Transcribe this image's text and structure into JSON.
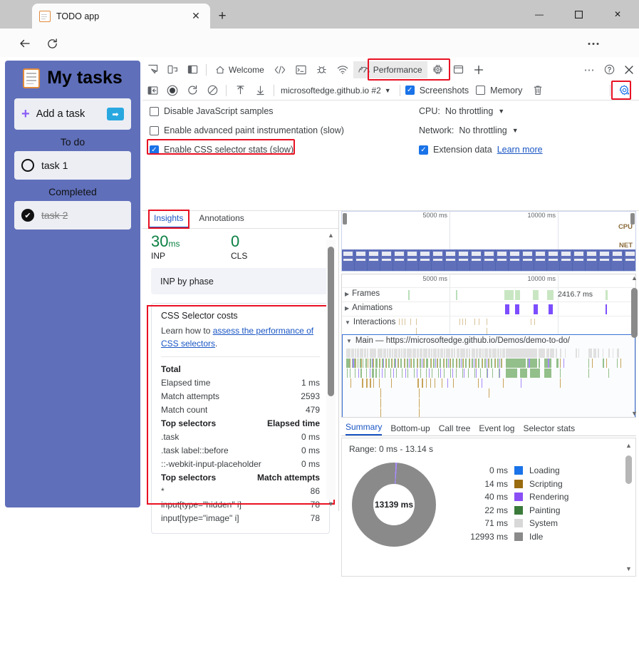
{
  "browser": {
    "tab_title": "TODO app",
    "url_prefix": "https://",
    "url_domain": "microsoftedge.github.io",
    "url_path": "/Demos/demo-to-do/",
    "new_tab_label": "+",
    "close_tab_label": "✕",
    "minimize_label": "—",
    "maximize_label": "❐",
    "close_label": "✕",
    "read_aloud_icon": "read-aloud-icon",
    "favorite_icon": "star-icon",
    "settings_more_icon": "ellipsis-icon",
    "copilot_icon": "copilot-icon"
  },
  "todo": {
    "title": "My tasks",
    "add_task_label": "Add a task",
    "add_task_submit": "➡",
    "sections": [
      {
        "heading": "To do",
        "tasks": [
          {
            "label": "task 1",
            "done": false
          }
        ]
      },
      {
        "heading": "Completed",
        "tasks": [
          {
            "label": "task 2",
            "done": true
          }
        ]
      }
    ]
  },
  "devtools": {
    "toolbar_row1": {
      "icons": [
        "inspect-icon",
        "device-toolbar-icon",
        "dock-side-icon"
      ],
      "panels": [
        {
          "label": "Welcome",
          "icon": "home-icon",
          "selected": false
        },
        {
          "label": "",
          "icon": "elements-icon",
          "selected": false
        },
        {
          "label": "",
          "icon": "console-icon",
          "selected": false
        },
        {
          "label": "",
          "icon": "sources-bug-icon",
          "selected": false
        },
        {
          "label": "",
          "icon": "network-icon",
          "selected": false
        },
        {
          "label": "Performance",
          "icon": "performance-icon",
          "selected": true
        },
        {
          "label": "",
          "icon": "memory-chip-icon",
          "selected": false
        },
        {
          "label": "",
          "icon": "application-icon",
          "selected": false
        },
        {
          "label": "",
          "icon": "add-panel-icon",
          "selected": false
        }
      ],
      "more_tools": "⋯",
      "help_icon": "help-icon",
      "close_icon": "close-icon"
    },
    "toolbar_row2": {
      "icons": [
        "back-to-page-icon",
        "record-icon",
        "reload-record-icon",
        "clear-icon",
        "upload-icon",
        "download-icon"
      ],
      "target_selector": "microsoftedge.github.io #2",
      "screenshots_label": "Screenshots",
      "screenshots_checked": true,
      "memory_label": "Memory",
      "memory_checked": false,
      "trash_icon": "trash-icon",
      "capture_settings_icon": "capture-settings-gear-icon"
    },
    "settings": {
      "checkboxes": [
        {
          "label": "Disable JavaScript samples",
          "checked": false
        },
        {
          "label": "Enable advanced paint instrumentation (slow)",
          "checked": false
        },
        {
          "label": "Enable CSS selector stats (slow)",
          "checked": true,
          "highlighted": true
        }
      ],
      "cpu_label": "CPU:",
      "cpu_value": "No throttling",
      "network_label": "Network:",
      "network_value": "No throttling",
      "extension_data_label": "Extension data",
      "extension_data_checked": true,
      "learn_more": "Learn more"
    }
  },
  "insights": {
    "tabs": [
      {
        "label": "Insights",
        "selected": true,
        "highlighted": true
      },
      {
        "label": "Annotations",
        "selected": false
      }
    ],
    "metrics": [
      {
        "value": "30",
        "unit": "ms",
        "label": "INP"
      },
      {
        "value": "0",
        "unit": "",
        "label": "CLS"
      }
    ],
    "inp_card": "INP by phase",
    "selector_card": {
      "title": "CSS Selector costs",
      "learn_prefix": "Learn how to ",
      "learn_link": "assess the performance of CSS selectors",
      "learn_suffix": ".",
      "total_heading": "Total",
      "total_rows": [
        {
          "key": "Elapsed time",
          "value": "1 ms"
        },
        {
          "key": "Match attempts",
          "value": "2593"
        },
        {
          "key": "Match count",
          "value": "479"
        }
      ],
      "top_elapsed_header": {
        "key": "Top selectors",
        "value": "Elapsed time"
      },
      "top_elapsed_rows": [
        {
          "key": ".task",
          "value": "0 ms"
        },
        {
          "key": ".task label::before",
          "value": "0 ms"
        },
        {
          "key": "::-webkit-input-placeholder",
          "value": "0 ms"
        }
      ],
      "top_attempts_header": {
        "key": "Top selectors",
        "value": "Match attempts"
      },
      "top_attempts_rows": [
        {
          "key": "*",
          "value": "86"
        },
        {
          "key": "input[type=\"hidden\" i]",
          "value": "78"
        },
        {
          "key": "input[type=\"image\" i]",
          "value": "78"
        }
      ]
    }
  },
  "timeline": {
    "overview_ticks": [
      "5000 ms",
      "10000 ms"
    ],
    "overview_labels": {
      "cpu": "CPU",
      "net": "NET"
    },
    "track_ticks": [
      "5000 ms",
      "10000 ms"
    ],
    "tracks": [
      {
        "label": "Frames",
        "expanded": false
      },
      {
        "label": "Animations",
        "expanded": false
      },
      {
        "label": "Interactions",
        "expanded": true
      }
    ],
    "frame_duration_label": "2416.7 ms",
    "main_track_label": "Main — https://microsoftedge.github.io/Demos/demo-to-do/",
    "bottom_tabs": [
      {
        "label": "Summary",
        "selected": true
      },
      {
        "label": "Bottom-up",
        "selected": false
      },
      {
        "label": "Call tree",
        "selected": false
      },
      {
        "label": "Event log",
        "selected": false
      },
      {
        "label": "Selector stats",
        "selected": false
      }
    ]
  },
  "chart_data": {
    "type": "pie",
    "title": "Range: 0 ms - 13.14 s",
    "center_label": "13139 ms",
    "categories": [
      "Loading",
      "Scripting",
      "Rendering",
      "Painting",
      "System",
      "Idle"
    ],
    "values": [
      0,
      14,
      40,
      22,
      71,
      12993
    ],
    "value_labels": [
      "0 ms",
      "14 ms",
      "40 ms",
      "22 ms",
      "71 ms",
      "12993 ms"
    ],
    "colors": [
      "#1a73e8",
      "#9a6c10",
      "#8a4ef5",
      "#3a7a3a",
      "#d8d8d8",
      "#8a8a8a"
    ],
    "unit": "ms",
    "legend_position": "right"
  },
  "colors": {
    "accent_blue": "#1a73e8",
    "highlight_red": "#e81123",
    "todo_bg": "#5f6fba",
    "green_metric": "#0b8043"
  }
}
